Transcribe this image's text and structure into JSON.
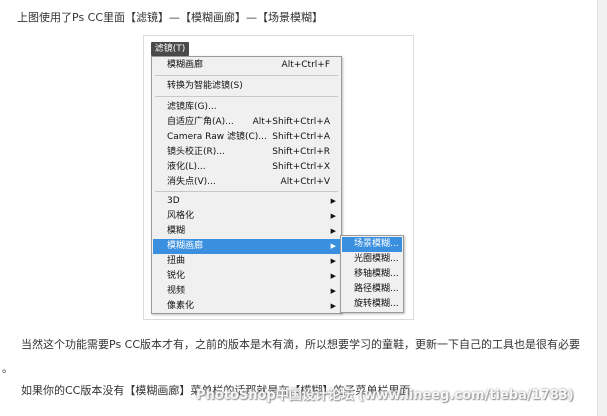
{
  "article": {
    "intro": "上图使用了Ps CC里面【滤镜】—【模糊画廊】—【场景模糊】",
    "para2_line1": "当然这个功能需要Ps CC版本才有，之前的版本是木有滴，所以想要学习的童鞋，更新一下自己的工具也是很有必要",
    "para2_line2": "。",
    "para3": "如果你的CC版本没有【模糊画廊】菜单栏的话那就是在【模糊】的子菜单栏里面"
  },
  "menu_tab": "滤镜(T)",
  "menu": {
    "items": [
      {
        "label": "模糊画廊",
        "shortcut": "Alt+Ctrl+F"
      },
      {
        "label": "转换为智能滤镜(S)",
        "shortcut": ""
      },
      {
        "label": "滤镜库(G)...",
        "shortcut": ""
      },
      {
        "label": "自适应广角(A)...",
        "shortcut": "Alt+Shift+Ctrl+A"
      },
      {
        "label": "Camera Raw 滤镜(C)...",
        "shortcut": "Shift+Ctrl+A"
      },
      {
        "label": "镜头校正(R)...",
        "shortcut": "Shift+Ctrl+R"
      },
      {
        "label": "液化(L)...",
        "shortcut": "Shift+Ctrl+X"
      },
      {
        "label": "消失点(V)...",
        "shortcut": "Alt+Ctrl+V"
      },
      {
        "label": "3D",
        "submenu": true
      },
      {
        "label": "风格化",
        "submenu": true
      },
      {
        "label": "模糊",
        "submenu": true
      },
      {
        "label": "模糊画廊",
        "submenu": true,
        "highlighted": true
      },
      {
        "label": "扭曲",
        "submenu": true
      },
      {
        "label": "锐化",
        "submenu": true
      },
      {
        "label": "视频",
        "submenu": true
      },
      {
        "label": "像素化",
        "submenu": true
      }
    ]
  },
  "submenu": {
    "items": [
      {
        "label": "场景模糊...",
        "highlighted": true
      },
      {
        "label": "光圈模糊..."
      },
      {
        "label": "移轴模糊..."
      },
      {
        "label": "路径模糊..."
      },
      {
        "label": "旋转模糊..."
      }
    ]
  },
  "watermark": "PhotoShop中国设计论坛 (www.lineeg.com/tieba/1783)",
  "colors": {
    "highlight": "#3a8fde",
    "menu_bg": "#f0f0f0",
    "tab_bg": "#4a4a4a"
  },
  "icons": {
    "submenu_arrow": "triangle-right-icon"
  }
}
